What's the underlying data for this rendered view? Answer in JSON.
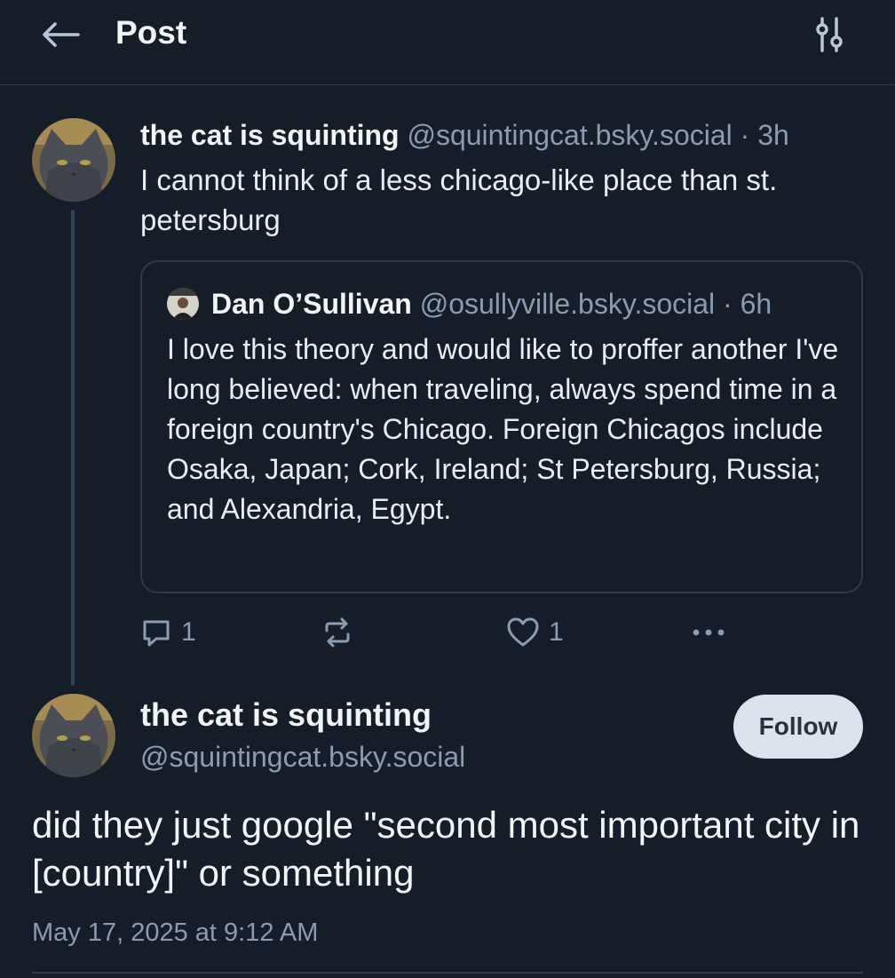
{
  "header": {
    "title": "Post",
    "back_icon": "arrow-left-icon",
    "filter_icon": "sliders-icon"
  },
  "parent_post": {
    "author_name": "the cat is squinting",
    "handle": "@squintingcat.bsky.social",
    "separator": "·",
    "time": "3h",
    "text": "I cannot think of a less chicago-like place than st. petersburg",
    "quote": {
      "author_name": "Dan O’Sullivan",
      "handle": "@osullyville.bsky.social",
      "separator": "·",
      "time": "6h",
      "text": "I love this theory and would like to proffer another I've long believed: when traveling, always spend time in a foreign country's Chicago. Foreign Chicagos include Osaka, Japan; Cork, Ireland; St Petersburg, Russia; and Alexandria, Egypt."
    },
    "actions": {
      "reply_count": "1",
      "repost_count": "",
      "like_count": "1"
    }
  },
  "focus_post": {
    "author_name": "the cat is squinting",
    "handle": "@squintingcat.bsky.social",
    "follow_label": "Follow",
    "text": "did they just google \"second most important city in [country]\" or something",
    "timestamp": "May 17, 2025 at 9:12 AM"
  },
  "colors": {
    "background": "#151d28",
    "muted_text": "#8b9bb0",
    "border": "#2e3b4c",
    "follow_bg": "#dde3ea"
  }
}
